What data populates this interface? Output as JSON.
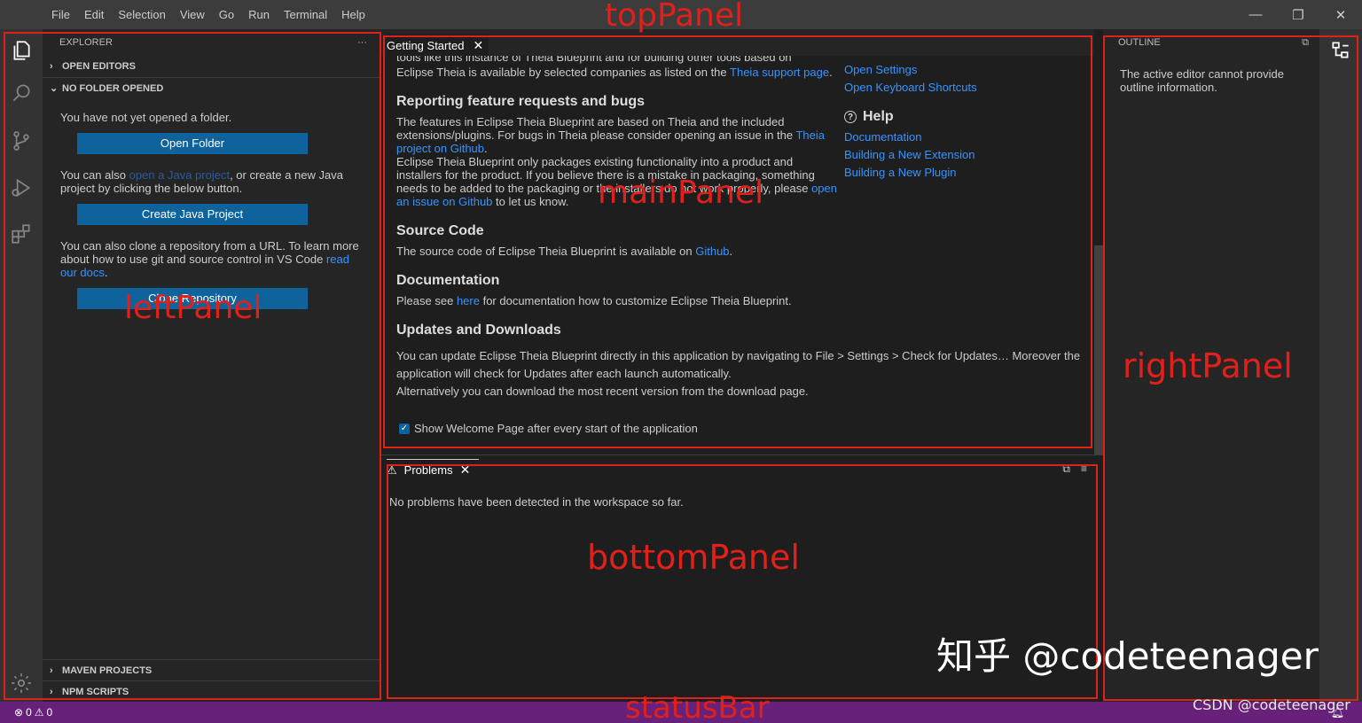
{
  "menubar": {
    "items": [
      "File",
      "Edit",
      "Selection",
      "View",
      "Go",
      "Run",
      "Terminal",
      "Help"
    ]
  },
  "activity": {
    "icons": [
      "files-icon",
      "search-icon",
      "source-control-icon",
      "run-debug-icon",
      "extensions-icon",
      "settings-gear-icon"
    ]
  },
  "explorer": {
    "header": "EXPLORER",
    "more": "···",
    "open_editors": "OPEN EDITORS",
    "no_folder": "NO FOLDER OPENED",
    "msg_not_opened": "You have not yet opened a folder.",
    "open_folder_btn": "Open Folder",
    "java_prefix": "You can also ",
    "java_link": "open a Java project",
    "java_suffix": ", or create a new Java project by clicking the below button.",
    "create_java_btn": "Create Java Project",
    "clone_text": "You can also clone a repository from a URL. To learn more about how to use git and source control in VS Code ",
    "clone_link": "read our docs",
    "clone_end": ".",
    "clone_btn": "Clone Repository",
    "maven": "MAVEN PROJECTS",
    "npm": "NPM SCRIPTS"
  },
  "editor": {
    "tab_label": "Getting Started",
    "cut_line": "tools like this instance of Theia Blueprint and for building other tools based on",
    "support_text": "Eclipse Theia is available by selected companies as listed on the ",
    "support_link": "Theia support page",
    "support_end": ".",
    "bugs_title": "Reporting feature requests and bugs",
    "bugs_p1": "The features in Eclipse Theia Blueprint are based on Theia and the included extensions/plugins. For bugs in Theia please consider opening an issue in the ",
    "bugs_link1": "Theia project on Github",
    "bugs_p1_end": ".",
    "bugs_p2": "Eclipse Theia Blueprint only packages existing functionality into a product and installers for the product. If you believe there is a mistake in packaging, something needs to be added to the packaging or the installers do not work properly, please ",
    "bugs_link2": "open an issue on Github",
    "bugs_p2_end": " to let us know.",
    "source_title": "Source Code",
    "source_text": "The source code of Eclipse Theia Blueprint is available on ",
    "source_link": "Github",
    "source_end": ".",
    "docs_title": "Documentation",
    "docs_prefix": "Please see ",
    "docs_link": "here",
    "docs_suffix": " for documentation how to customize Eclipse Theia Blueprint.",
    "updates_title": "Updates and Downloads",
    "updates_p1": "You can update Eclipse Theia Blueprint directly in this application by navigating to File > Settings > Check for Updates… Moreover the application will check for Updates after each launch automatically.",
    "updates_p2": "Alternatively you can download the most recent version from the download page.",
    "checkbox_label": "Show Welcome Page after every start of the application",
    "right_links": [
      "Open Settings",
      "Open Keyboard Shortcuts"
    ],
    "help_title": "Help",
    "help_links": [
      "Documentation",
      "Building a New Extension",
      "Building a New Plugin"
    ]
  },
  "problems": {
    "tab_label": "Problems",
    "message": "No problems have been detected in the workspace so far."
  },
  "outline": {
    "header": "OUTLINE",
    "message": "The active editor cannot provide outline information."
  },
  "statusbar": {
    "errors": "0",
    "warnings": "0"
  },
  "annotations": {
    "top": "topPanel",
    "left": "leftPanel",
    "main": "mainPanel",
    "right": "rightPanel",
    "bottom": "bottomPanel",
    "status": "statusBar"
  },
  "watermarks": {
    "zhihu": "知乎 @codeteenager",
    "csdn": "CSDN @codeteenager"
  },
  "colors": {
    "accent": "#0e639c",
    "link": "#3794ff",
    "status_bar": "#68217a",
    "annotation": "#e0201a"
  }
}
